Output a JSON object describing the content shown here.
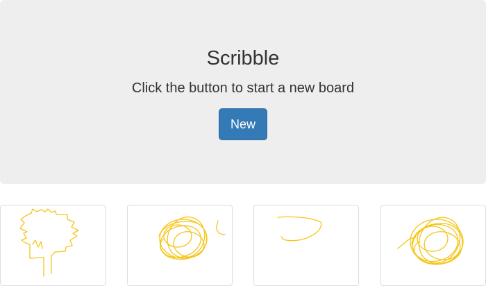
{
  "hero": {
    "title": "Scribble",
    "subtitle": "Click the button to start a new board",
    "new_button_label": "New"
  },
  "boards": [
    {
      "name": "board-thumbnail-1",
      "drawing": "tree sketch"
    },
    {
      "name": "board-thumbnail-2",
      "drawing": "scribble loops"
    },
    {
      "name": "board-thumbnail-3",
      "drawing": "curved stroke"
    },
    {
      "name": "board-thumbnail-4",
      "drawing": "scribble loops"
    }
  ],
  "colors": {
    "hero_background": "#eeeeee",
    "button_primary": "#337ab7",
    "stroke": "#f5c518"
  }
}
